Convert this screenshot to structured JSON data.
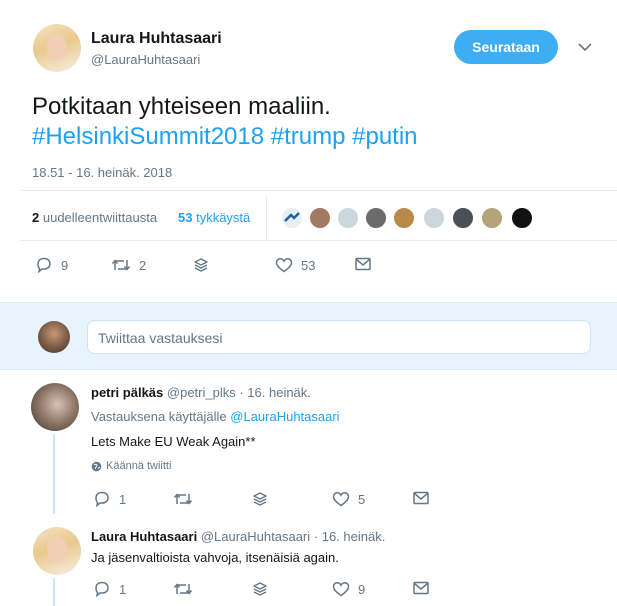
{
  "tweet": {
    "author_name": "Laura Huhtasaari",
    "author_handle": "@LauraHuhtasaari",
    "follow_label": "Seurataan",
    "text": "Potkitaan yhteiseen maaliin.",
    "hashtags": "#HelsinkiSummit2018 #trump #putin",
    "timestamp": "18.51 - 16. heinäk. 2018",
    "retweets_count": "2",
    "retweets_label": "uudelleentwiittausta",
    "likes_count": "53",
    "likes_label": "tykkäystä",
    "actions": {
      "replies": "9",
      "retweets": "2",
      "likes": "53"
    }
  },
  "reply_input": {
    "placeholder": "Twiittaa vastauksesi"
  },
  "replies": [
    {
      "author_name": "petri pälkäs",
      "author_handle": "@petri_plks",
      "date": "· 16. heinäk.",
      "replying_to_label": "Vastauksena käyttäjälle",
      "replying_to_handle": "@LauraHuhtasaari",
      "text": "Lets Make EU Weak Again**",
      "translate_label": "Käännä twiitti",
      "actions": {
        "replies": "1",
        "retweets": "",
        "likes": "5"
      }
    },
    {
      "author_name": "Laura Huhtasaari",
      "author_handle": "@LauraHuhtasaari",
      "date": "· 16. heinäk.",
      "text": "Ja jäsenvaltioista vahvoja, itsenäisiä again.",
      "actions": {
        "replies": "1",
        "retweets": "",
        "likes": "9"
      }
    }
  ],
  "colors": {
    "accent": "#1da1f2",
    "text": "#14171a",
    "secondary": "#657786",
    "divider": "#e6ecf0",
    "thread_line": "#cce6f9"
  },
  "icons": [
    "chevron-down-icon",
    "reply-icon",
    "retweet-icon",
    "share-icon",
    "heart-icon",
    "envelope-icon",
    "globe-icon"
  ]
}
